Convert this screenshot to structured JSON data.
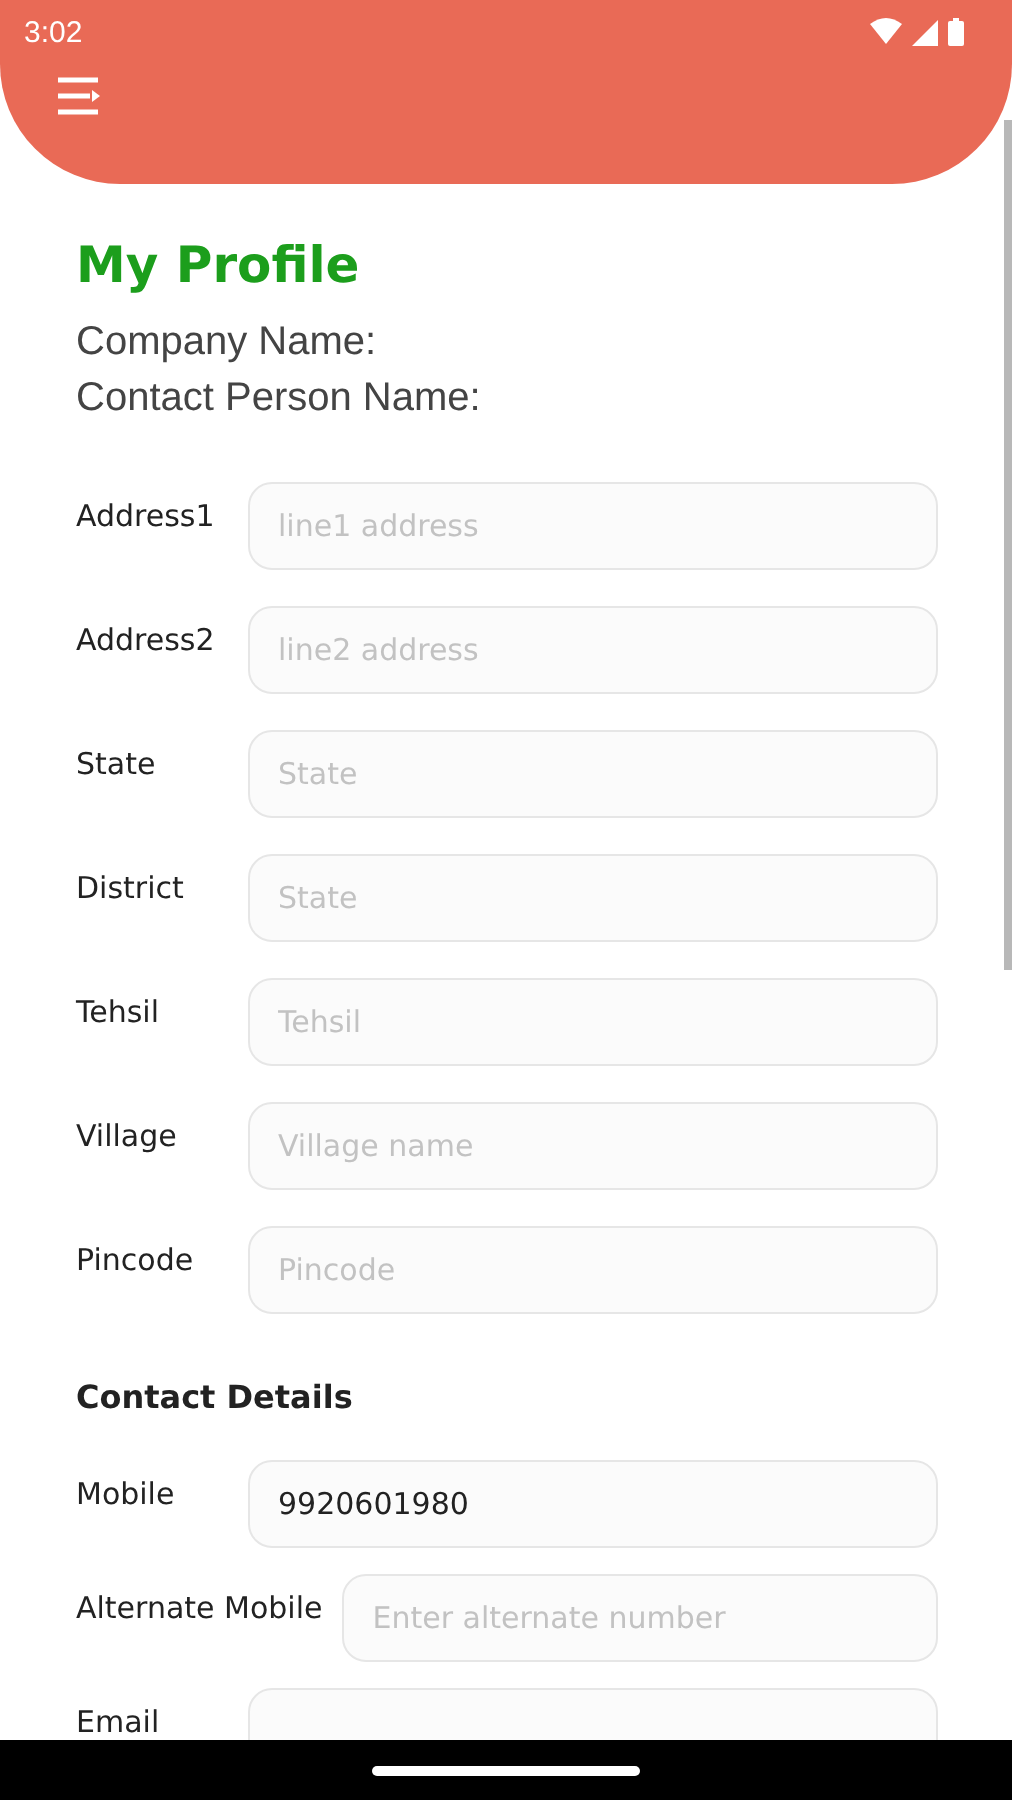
{
  "status_bar": {
    "time": "3:02"
  },
  "page": {
    "title": "My Profile",
    "info": [
      "Company Name:",
      "Contact Person Name:"
    ]
  },
  "address_fields": [
    {
      "label": "Address1",
      "placeholder": "line1 address"
    },
    {
      "label": "Address2",
      "placeholder": "line2 address"
    },
    {
      "label": "State",
      "placeholder": "State"
    },
    {
      "label": "District",
      "placeholder": "State"
    },
    {
      "label": "Tehsil",
      "placeholder": "Tehsil"
    },
    {
      "label": "Village",
      "placeholder": "Village name"
    },
    {
      "label": "Pincode",
      "placeholder": "Pincode"
    }
  ],
  "contact_section": {
    "heading": "Contact Details",
    "fields": [
      {
        "label": "Mobile",
        "value": "9920601980"
      },
      {
        "label": "Alternate Mobile",
        "placeholder": "Enter alternate number"
      },
      {
        "label": "Email"
      }
    ]
  }
}
